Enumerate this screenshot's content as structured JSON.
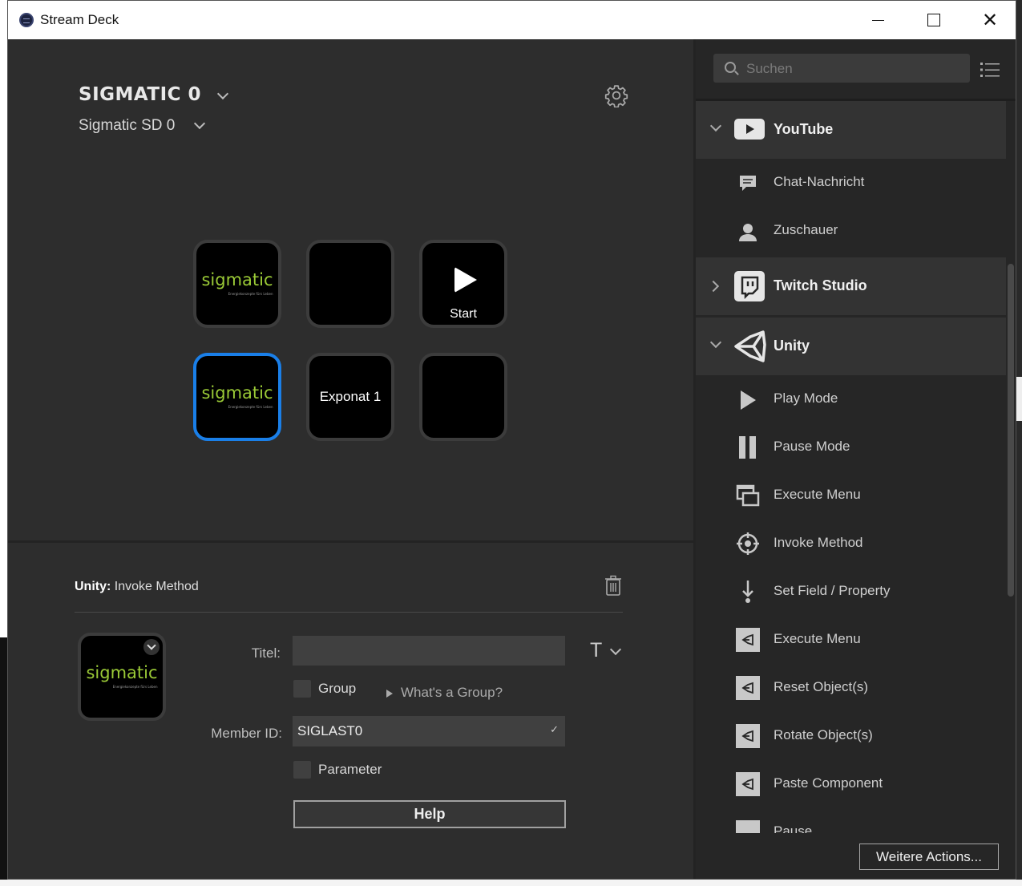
{
  "window": {
    "title": "Stream Deck"
  },
  "device": {
    "profile_name": "SIGMATIC 0",
    "device_name": "Sigmatic SD 0"
  },
  "keys": [
    {
      "type": "logo",
      "text": "sigmatic",
      "tagline": "Energiekonzepte fürs Leben"
    },
    {
      "type": "empty"
    },
    {
      "type": "play",
      "label": "Start"
    },
    {
      "type": "logo",
      "text": "sigmatic",
      "tagline": "Energiekonzepte fürs Leben",
      "selected": true
    },
    {
      "type": "text",
      "label": "Exponat 1"
    },
    {
      "type": "empty"
    }
  ],
  "inspector": {
    "plugin": "Unity:",
    "action": "Invoke Method",
    "thumb_logo": "sigmatic",
    "thumb_tagline": "Energiekonzepte fürs Leben",
    "title_label": "Titel:",
    "title_value": "",
    "group_label": "Group",
    "group_help": "What's a Group?",
    "member_label": "Member ID:",
    "member_value": "SIGLAST0",
    "parameter_label": "Parameter",
    "help_label": "Help",
    "text_tool": "T"
  },
  "panel": {
    "search_placeholder": "Suchen",
    "categories": [
      {
        "name": "YouTube",
        "expanded": true,
        "items": [
          "Chat-Nachricht",
          "Zuschauer"
        ]
      },
      {
        "name": "Twitch Studio",
        "expanded": false,
        "items": []
      },
      {
        "name": "Unity",
        "expanded": true,
        "items": [
          "Play Mode",
          "Pause Mode",
          "Execute Menu",
          "Invoke Method",
          "Set Field / Property",
          "Execute Menu",
          "Reset Object(s)",
          "Rotate Object(s)",
          "Paste Component",
          "Pause"
        ]
      }
    ],
    "more_button": "Weitere Actions..."
  },
  "colors": {
    "accent": "#1a7fe8",
    "logo_green": "#9ac936",
    "panel_bg": "#262626",
    "category_bg": "#333333"
  }
}
